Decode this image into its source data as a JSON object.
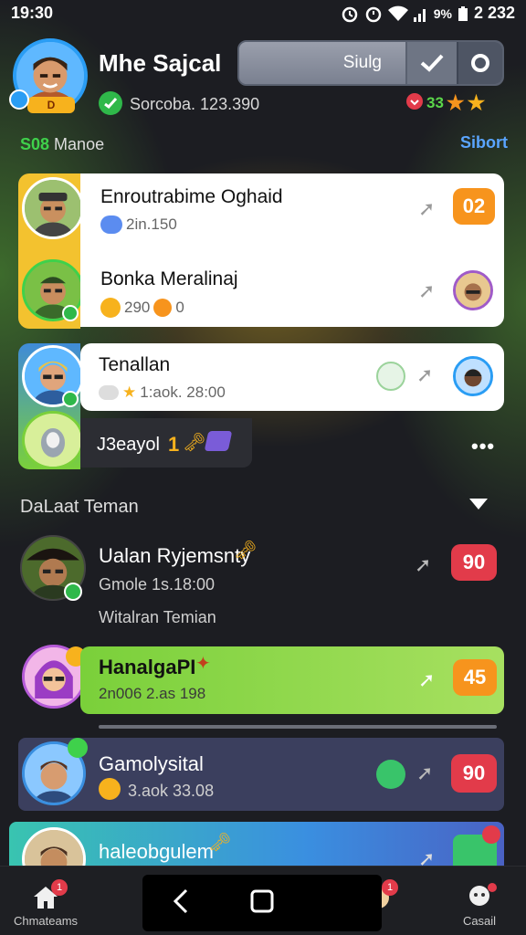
{
  "status": {
    "time": "19:30",
    "battery_text": "9%",
    "clock_right": "2 232"
  },
  "profile": {
    "name": "Mhe Sajcal",
    "subtitle": "Sorcoba. 123.390",
    "avatar_badge": "D",
    "pill_label": "Siulg",
    "score": "33"
  },
  "section": {
    "left_prefix": "S08",
    "left_label": "Manoe",
    "right_label": "Sibort"
  },
  "chats_top": [
    {
      "title": "Enroutrabime Oghaid",
      "sub": "2in.150",
      "count": "02",
      "count_color": "#f7941d"
    },
    {
      "title": "Bonka Meralinaj",
      "sub": "290",
      "sub_extra": "0"
    },
    {
      "title": "Tenallan",
      "sub": "1:aok. 28:00"
    },
    {
      "title": "J3eayol",
      "title_extra": "1"
    }
  ],
  "friends_header": "DaLaat Teman",
  "chats_bottom": [
    {
      "title": "Ualan Ryjemsnty",
      "sub": "Gmole 1s.18:00",
      "extra": "Witalran Temian",
      "count": "90"
    },
    {
      "title": "HanalgaPI",
      "sub": "2n006 2.as 198",
      "count": "45"
    },
    {
      "title": "Gamolysital",
      "sub": "3.aok 33.08",
      "count": "90"
    },
    {
      "title": "haleobgulem"
    }
  ],
  "nav": {
    "home_label": "Chmateams",
    "home_badge": "1",
    "chat_badge": "1",
    "profile_label": "Casail"
  },
  "colors": {
    "accent_green": "#3fd14b",
    "accent_blue": "#5aa5ff",
    "badge_red": "#e23b4a",
    "badge_orange": "#f7941d"
  }
}
